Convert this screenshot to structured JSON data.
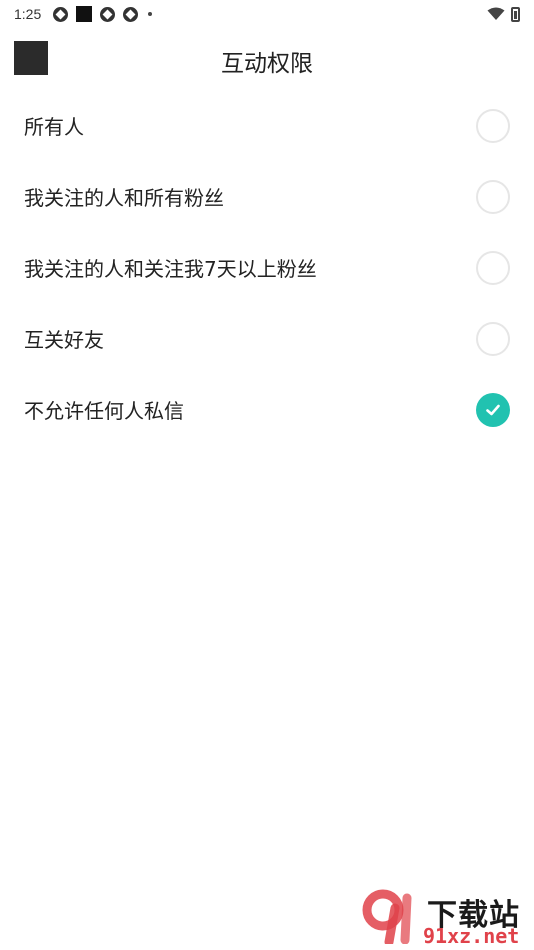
{
  "status_bar": {
    "time": "1:25",
    "icons": [
      "aperture-icon",
      "square-icon",
      "aperture-icon",
      "aperture-icon",
      "dot-icon"
    ],
    "right_icons": [
      "wifi-icon",
      "battery-icon"
    ]
  },
  "header": {
    "title": "互动权限",
    "back_icon": "back-icon"
  },
  "options": [
    {
      "label": "所有人",
      "checked": false
    },
    {
      "label": "我关注的人和所有粉丝",
      "checked": false
    },
    {
      "label": "我关注的人和关注我7天以上粉丝",
      "checked": false
    },
    {
      "label": "互关好友",
      "checked": false
    },
    {
      "label": "不允许任何人私信",
      "checked": true
    }
  ],
  "colors": {
    "accent": "#21c2b0",
    "radio_border": "#e6e6e6",
    "text": "#222222",
    "watermark_red": "#e0424a"
  },
  "watermark": {
    "title": "下载站",
    "domain": "91xz.net",
    "logo_text": "9"
  }
}
